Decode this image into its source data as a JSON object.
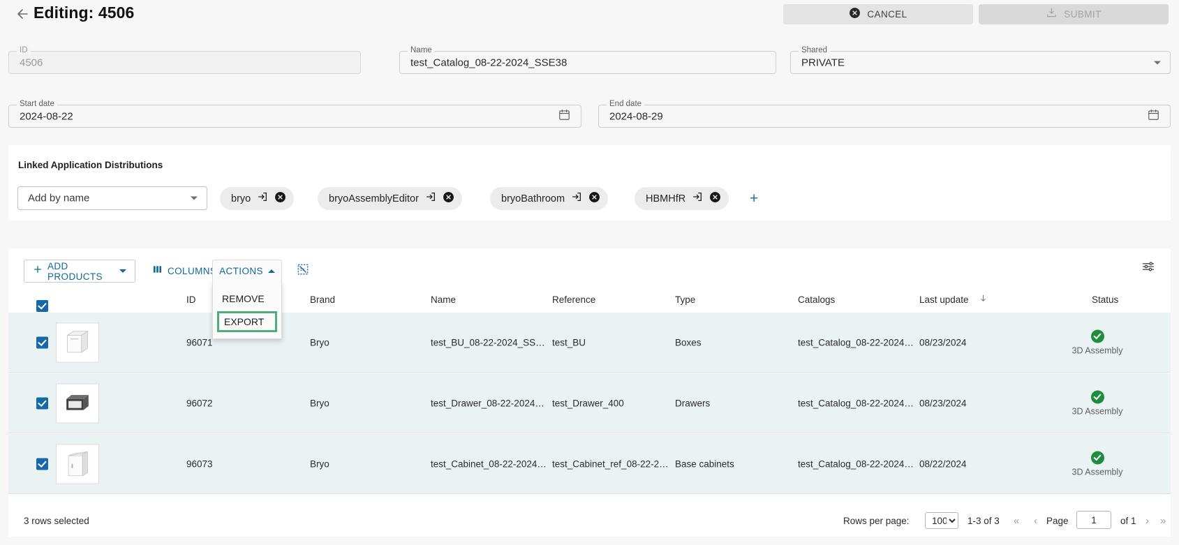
{
  "header": {
    "back_icon": "arrow-left-icon",
    "title": "Editing: 4506",
    "cancel_label": "CANCEL",
    "cancel_icon": "cancel-circle-icon",
    "submit_label": "SUBMIT",
    "submit_icon": "save-download-icon"
  },
  "form": {
    "id": {
      "label": "ID",
      "value": "4506"
    },
    "name": {
      "label": "Name",
      "value": "test_Catalog_08-22-2024_SSE38"
    },
    "shared": {
      "label": "Shared",
      "value": "PRIVATE",
      "icon": "chevron-down-icon"
    },
    "start_date": {
      "label": "Start date",
      "value": "2024-08-22",
      "icon": "calendar-icon"
    },
    "end_date": {
      "label": "End date",
      "value": "2024-08-29",
      "icon": "calendar-icon"
    }
  },
  "linked": {
    "title": "Linked Application Distributions",
    "add_by_name": "Add by name",
    "add_icon": "chevron-down-icon",
    "plus_label": "+",
    "chips": [
      {
        "name": "bryo",
        "open_icon": "open-in-icon",
        "remove_icon": "remove-circle-icon"
      },
      {
        "name": "bryoAssemblyEditor",
        "open_icon": "open-in-icon",
        "remove_icon": "remove-circle-icon"
      },
      {
        "name": "bryoBathroom",
        "open_icon": "open-in-icon",
        "remove_icon": "remove-circle-icon"
      },
      {
        "name": "HBMHfR",
        "open_icon": "open-in-icon",
        "remove_icon": "remove-circle-icon"
      }
    ]
  },
  "toolbar": {
    "add_products": "ADD PRODUCTS",
    "add_products_icon": "plus-icon",
    "columns": "COLUMNS",
    "columns_icon": "columns-icon",
    "actions": "ACTIONS",
    "actions_icon": "chevron-up-icon",
    "select_icon": "deselect-all-icon",
    "settings_icon": "table-settings-icon"
  },
  "actions_menu": {
    "items": [
      {
        "label": "REMOVE",
        "highlighted": false
      },
      {
        "label": "EXPORT",
        "highlighted": true
      }
    ],
    "highlight_color": "#4caf77"
  },
  "table": {
    "columns": [
      "ID",
      "Brand",
      "Name",
      "Reference",
      "Type",
      "Catalogs",
      "Last update",
      "Status"
    ],
    "sort_column": "Last update",
    "sort_icon": "arrow-down-icon",
    "header_checkbox_checked": true,
    "rows": [
      {
        "checked": true,
        "thumbnail": "product-thumbnail-boxes",
        "id": "96071",
        "brand": "Bryo",
        "name": "test_BU_08-22-2024_SS…",
        "reference": "test_BU",
        "type": "Boxes",
        "catalogs": "test_Catalog_08-22-2024…",
        "last_update": "08/23/2024",
        "status_icon": "check-circle-icon",
        "status": "3D Assembly"
      },
      {
        "checked": true,
        "thumbnail": "product-thumbnail-drawer",
        "id": "96072",
        "brand": "Bryo",
        "name": "test_Drawer_08-22-2024…",
        "reference": "test_Drawer_400",
        "type": "Drawers",
        "catalogs": "test_Catalog_08-22-2024…",
        "last_update": "08/23/2024",
        "status_icon": "check-circle-icon",
        "status": "3D Assembly"
      },
      {
        "checked": true,
        "thumbnail": "product-thumbnail-cabinet",
        "id": "96073",
        "brand": "Bryo",
        "name": "test_Cabinet_08-22-2024…",
        "reference": "test_Cabinet_ref_08-22-2…",
        "type": "Base cabinets",
        "catalogs": "test_Catalog_08-22-2024…",
        "last_update": "08/22/2024",
        "status_icon": "check-circle-icon",
        "status": "3D Assembly"
      }
    ]
  },
  "footer": {
    "rows_selected": "3 rows selected",
    "rows_per_page_label": "Rows per page:",
    "rows_per_page_value": "100",
    "range": "1-3 of 3",
    "first_icon": "«",
    "prev_icon": "‹",
    "page_label": "Page",
    "page_value": "1",
    "of_label": "of  1",
    "next_icon": "›",
    "last_icon": "»"
  }
}
